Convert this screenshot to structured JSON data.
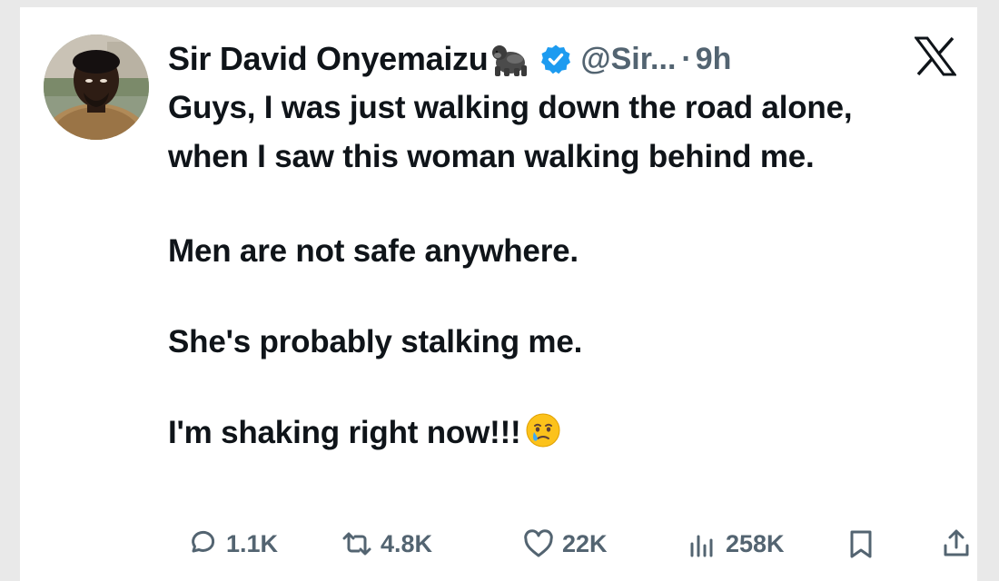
{
  "tweet": {
    "author_name": "Sir David Onyemaizu",
    "author_emoji_icon": "gorilla-icon",
    "verified_icon": "verified-badge-icon",
    "handle": "@Sir...",
    "separator": "·",
    "time": "9h",
    "platform_icon": "x-logo-icon",
    "lines": {
      "p1": "Guys, I was just walking down the road alone, when I saw this woman  walking behind me.",
      "p2": "Men are not safe anywhere.",
      "p3": "She's probably stalking me.",
      "p4": "I'm shaking right now!!!"
    },
    "trailing_emoji_icon": "face-holding-back-tears-icon"
  },
  "actions": {
    "replies": "1.1K",
    "retweets": "4.8K",
    "likes": "22K",
    "views": "258K"
  },
  "colors": {
    "text": "#0f1419",
    "secondary": "#536471",
    "verified": "#1d9bf0"
  }
}
